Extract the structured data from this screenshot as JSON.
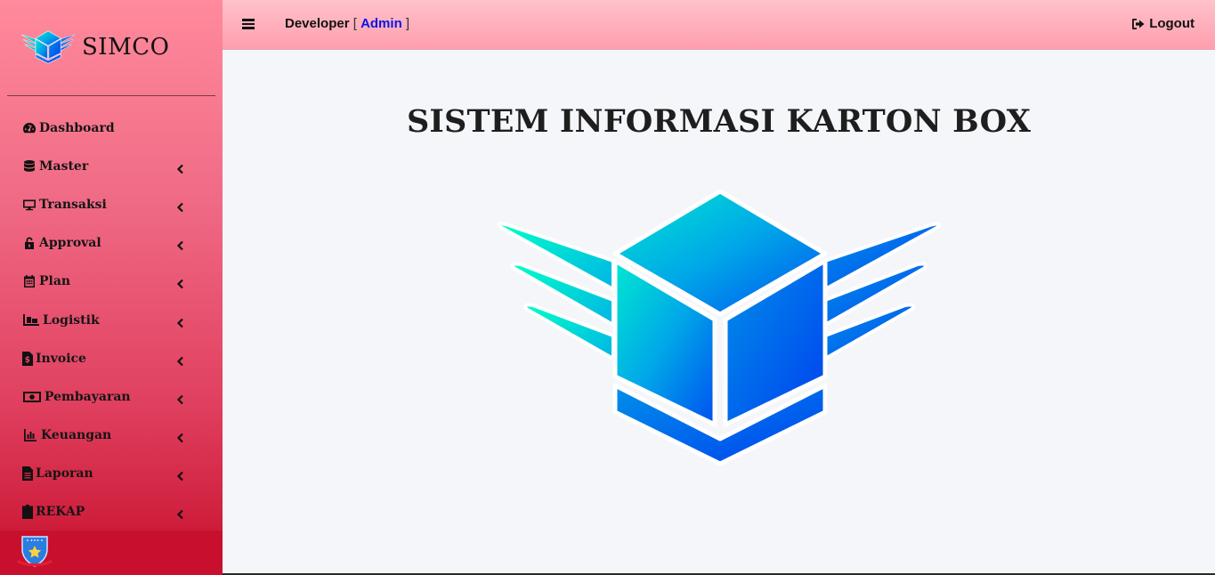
{
  "brand": {
    "name": "SIMCO",
    "logo_icon": "winged-box-icon"
  },
  "topbar": {
    "menu_icon": "hamburger-icon",
    "user_name": "Developer",
    "bracket_open": "[",
    "user_role": "Admin",
    "bracket_close": "]",
    "logout_label": "Logout",
    "logout_icon": "sign-out-icon"
  },
  "sidebar": {
    "items": [
      {
        "label": "Dashboard",
        "icon": "tachometer-icon",
        "expandable": false
      },
      {
        "label": "Master",
        "icon": "database-icon",
        "expandable": true
      },
      {
        "label": "Transaksi",
        "icon": "desktop-icon",
        "expandable": true
      },
      {
        "label": "Approval",
        "icon": "unlock-icon",
        "expandable": true
      },
      {
        "label": "Plan",
        "icon": "calendar-icon",
        "expandable": true
      },
      {
        "label": "Logistik",
        "icon": "pallet-icon",
        "expandable": true
      },
      {
        "label": "Invoice",
        "icon": "file-invoice-dollar-icon",
        "expandable": true
      },
      {
        "label": "Pembayaran",
        "icon": "money-bill-icon",
        "expandable": true
      },
      {
        "label": "Keuangan",
        "icon": "bar-chart-icon",
        "expandable": true
      },
      {
        "label": "Laporan",
        "icon": "file-text-icon",
        "expandable": true
      },
      {
        "label": "REKAP",
        "icon": "clipboard-icon",
        "expandable": true
      }
    ],
    "footer_icon": "shield-emblem-icon"
  },
  "main": {
    "title": "SISTEM INFORMASI KARTON BOX",
    "hero_icon": "winged-box-icon"
  },
  "colors": {
    "sidebar_top": "#ff8a9c",
    "sidebar_bottom": "#c8102e",
    "topbar": "#ffb3be",
    "role_link": "#0b15e6",
    "logo_cyan": "#00f0c8",
    "logo_blue": "#0050f0"
  }
}
